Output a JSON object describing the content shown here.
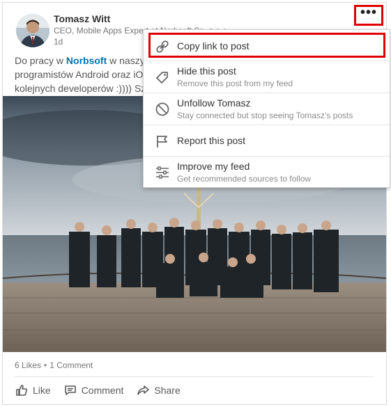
{
  "post": {
    "author_name": "Tomasz Witt",
    "author_title": "CEO, Mobile Apps Expert at Norbsoft Sp. z o.o.",
    "time": "1d",
    "text_line1_before": "Do pracy w ",
    "text_link": "Norbsoft",
    "text_line1_after": " w naszym",
    "text_line2": "programistów Android oraz iO",
    "text_line3": "kolejnych developerów :)))) Sz",
    "likes": "6 Likes",
    "comments": "1 Comment"
  },
  "actions": {
    "like": "Like",
    "comment": "Comment",
    "share": "Share"
  },
  "menu": {
    "items": [
      {
        "title": "Copy link to post",
        "subtitle": "",
        "icon": "link-icon"
      },
      {
        "title": "Hide this post",
        "subtitle": "Remove this post from my feed",
        "icon": "tag-icon"
      },
      {
        "title": "Unfollow Tomasz",
        "subtitle": "Stay connected but stop seeing Tomasz’s posts",
        "icon": "block-icon"
      },
      {
        "title": "Report this post",
        "subtitle": "",
        "icon": "flag-icon"
      },
      {
        "title": "Improve my feed",
        "subtitle": "Get recommended sources to follow",
        "icon": "sliders-icon"
      }
    ]
  },
  "more_button": "•••",
  "colors": {
    "link": "#0073b1",
    "highlight": "#e00000",
    "muted": "#767676"
  }
}
